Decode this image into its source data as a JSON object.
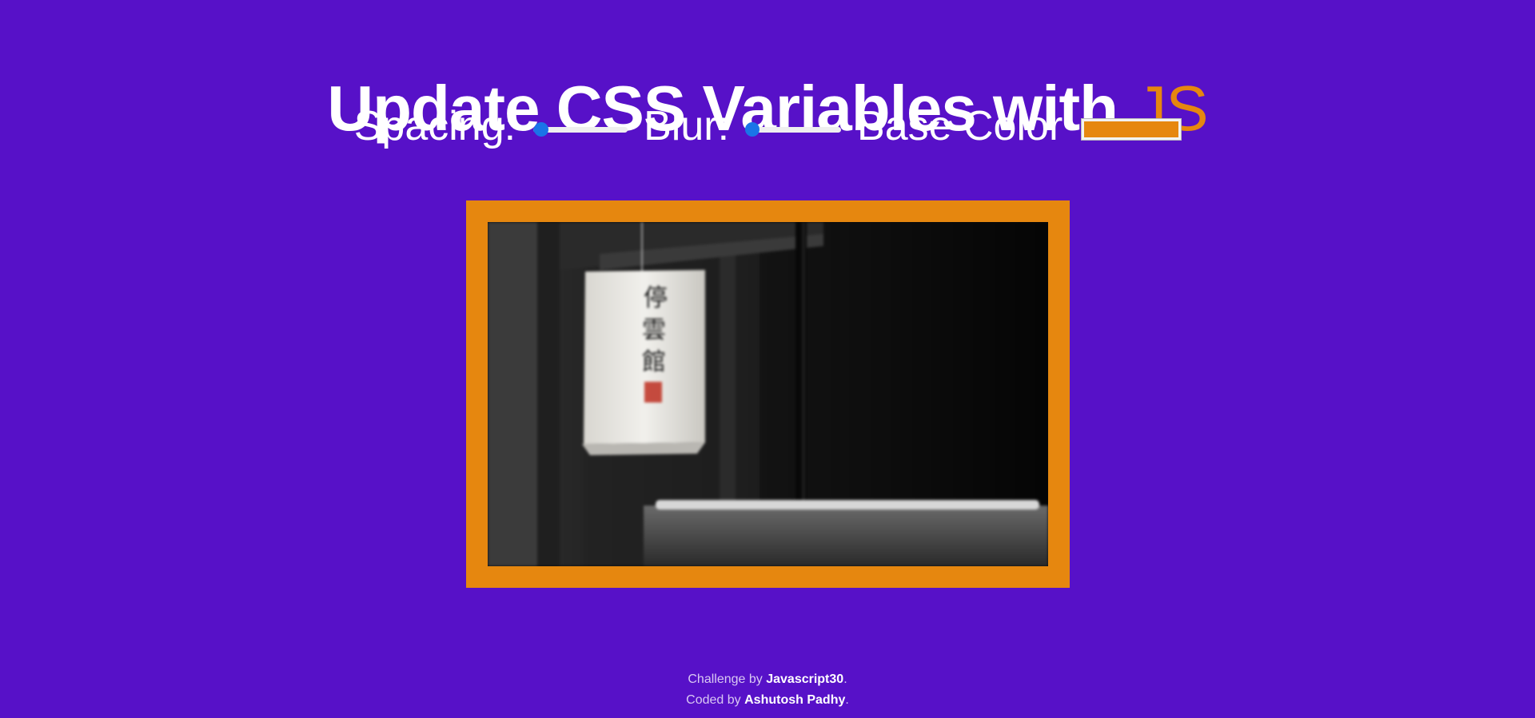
{
  "header": {
    "title_main": "Update CSS Variables with",
    "title_accent": "JS"
  },
  "controls": {
    "spacing_label": "Spacing:",
    "spacing_value": 0.08,
    "blur_label": "Blur:",
    "blur_value": 0.06,
    "base_color_label": "Base Color",
    "base_color_value": "#e6870f"
  },
  "colors": {
    "background": "#5711c8",
    "accent": "#e6870f",
    "slider_accent": "#1a74e8"
  },
  "image": {
    "lantern_text": "停雲館"
  },
  "footer": {
    "challenge_prefix": "Challenge by",
    "challenge_link": "Javascript30",
    "challenge_suffix": ".",
    "coded_prefix": "Coded by",
    "coded_link": "Ashutosh Padhy",
    "coded_suffix": "."
  }
}
